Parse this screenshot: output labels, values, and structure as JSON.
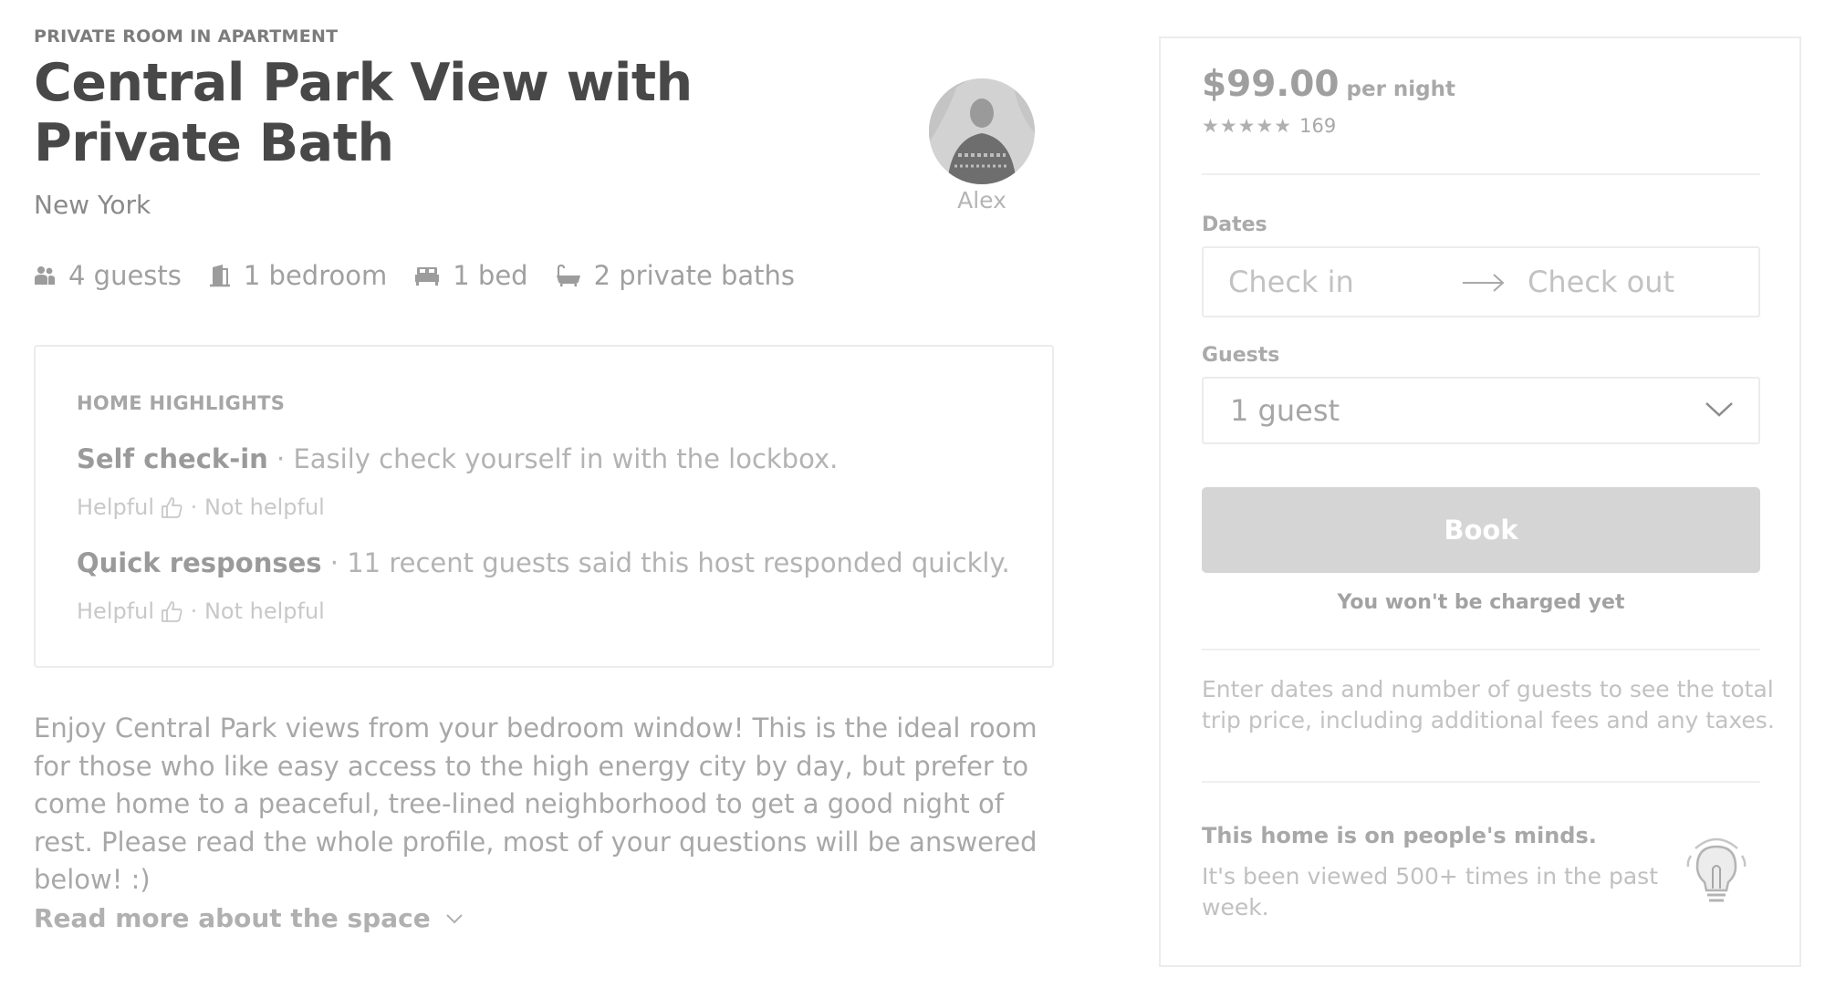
{
  "listing": {
    "room_type": "PRIVATE ROOM IN APARTMENT",
    "title": "Central Park View with Private Bath",
    "city": "New York",
    "host_name": "Alex",
    "amenities": [
      {
        "icon": "guests-icon",
        "label": "4 guests"
      },
      {
        "icon": "bedroom-icon",
        "label": "1 bedroom"
      },
      {
        "icon": "bed-icon",
        "label": "1 bed"
      },
      {
        "icon": "bath-icon",
        "label": "2 private baths"
      }
    ]
  },
  "highlights": {
    "heading": "HOME HIGHLIGHTS",
    "items": [
      {
        "title": "Self check-in",
        "text": " · Easily check yourself in with the lockbox.",
        "helpful": "Helpful",
        "separator": " · ",
        "not_helpful": "Not helpful"
      },
      {
        "title": "Quick responses",
        "text": " · 11 recent guests said this host responded quickly.",
        "helpful": "Helpful",
        "separator": " · ",
        "not_helpful": "Not helpful"
      }
    ]
  },
  "description": "Enjoy Central Park views from your bedroom window! This is the ideal room for those who like easy access to the high energy city by day, but prefer to come home to a peaceful, tree-lined neighborhood to get a good night of rest. Please read the whole profile, most of your questions will be answered below! :)",
  "read_more": "Read more about the space",
  "booking": {
    "price": "$99.00",
    "per": "per night",
    "stars": "★★★★★",
    "review_count": "169",
    "dates_label": "Dates",
    "check_in": "Check in",
    "check_out": "Check out",
    "guests_label": "Guests",
    "guests_value": "1 guest",
    "book_label": "Book",
    "no_charge": "You won't be charged yet",
    "enter_info": "Enter dates and number of guests to see the total trip price, including additional fees and any taxes.",
    "minds_title": "This home is on people's minds.",
    "minds_sub": "It's been viewed 500+ times in the past week."
  }
}
